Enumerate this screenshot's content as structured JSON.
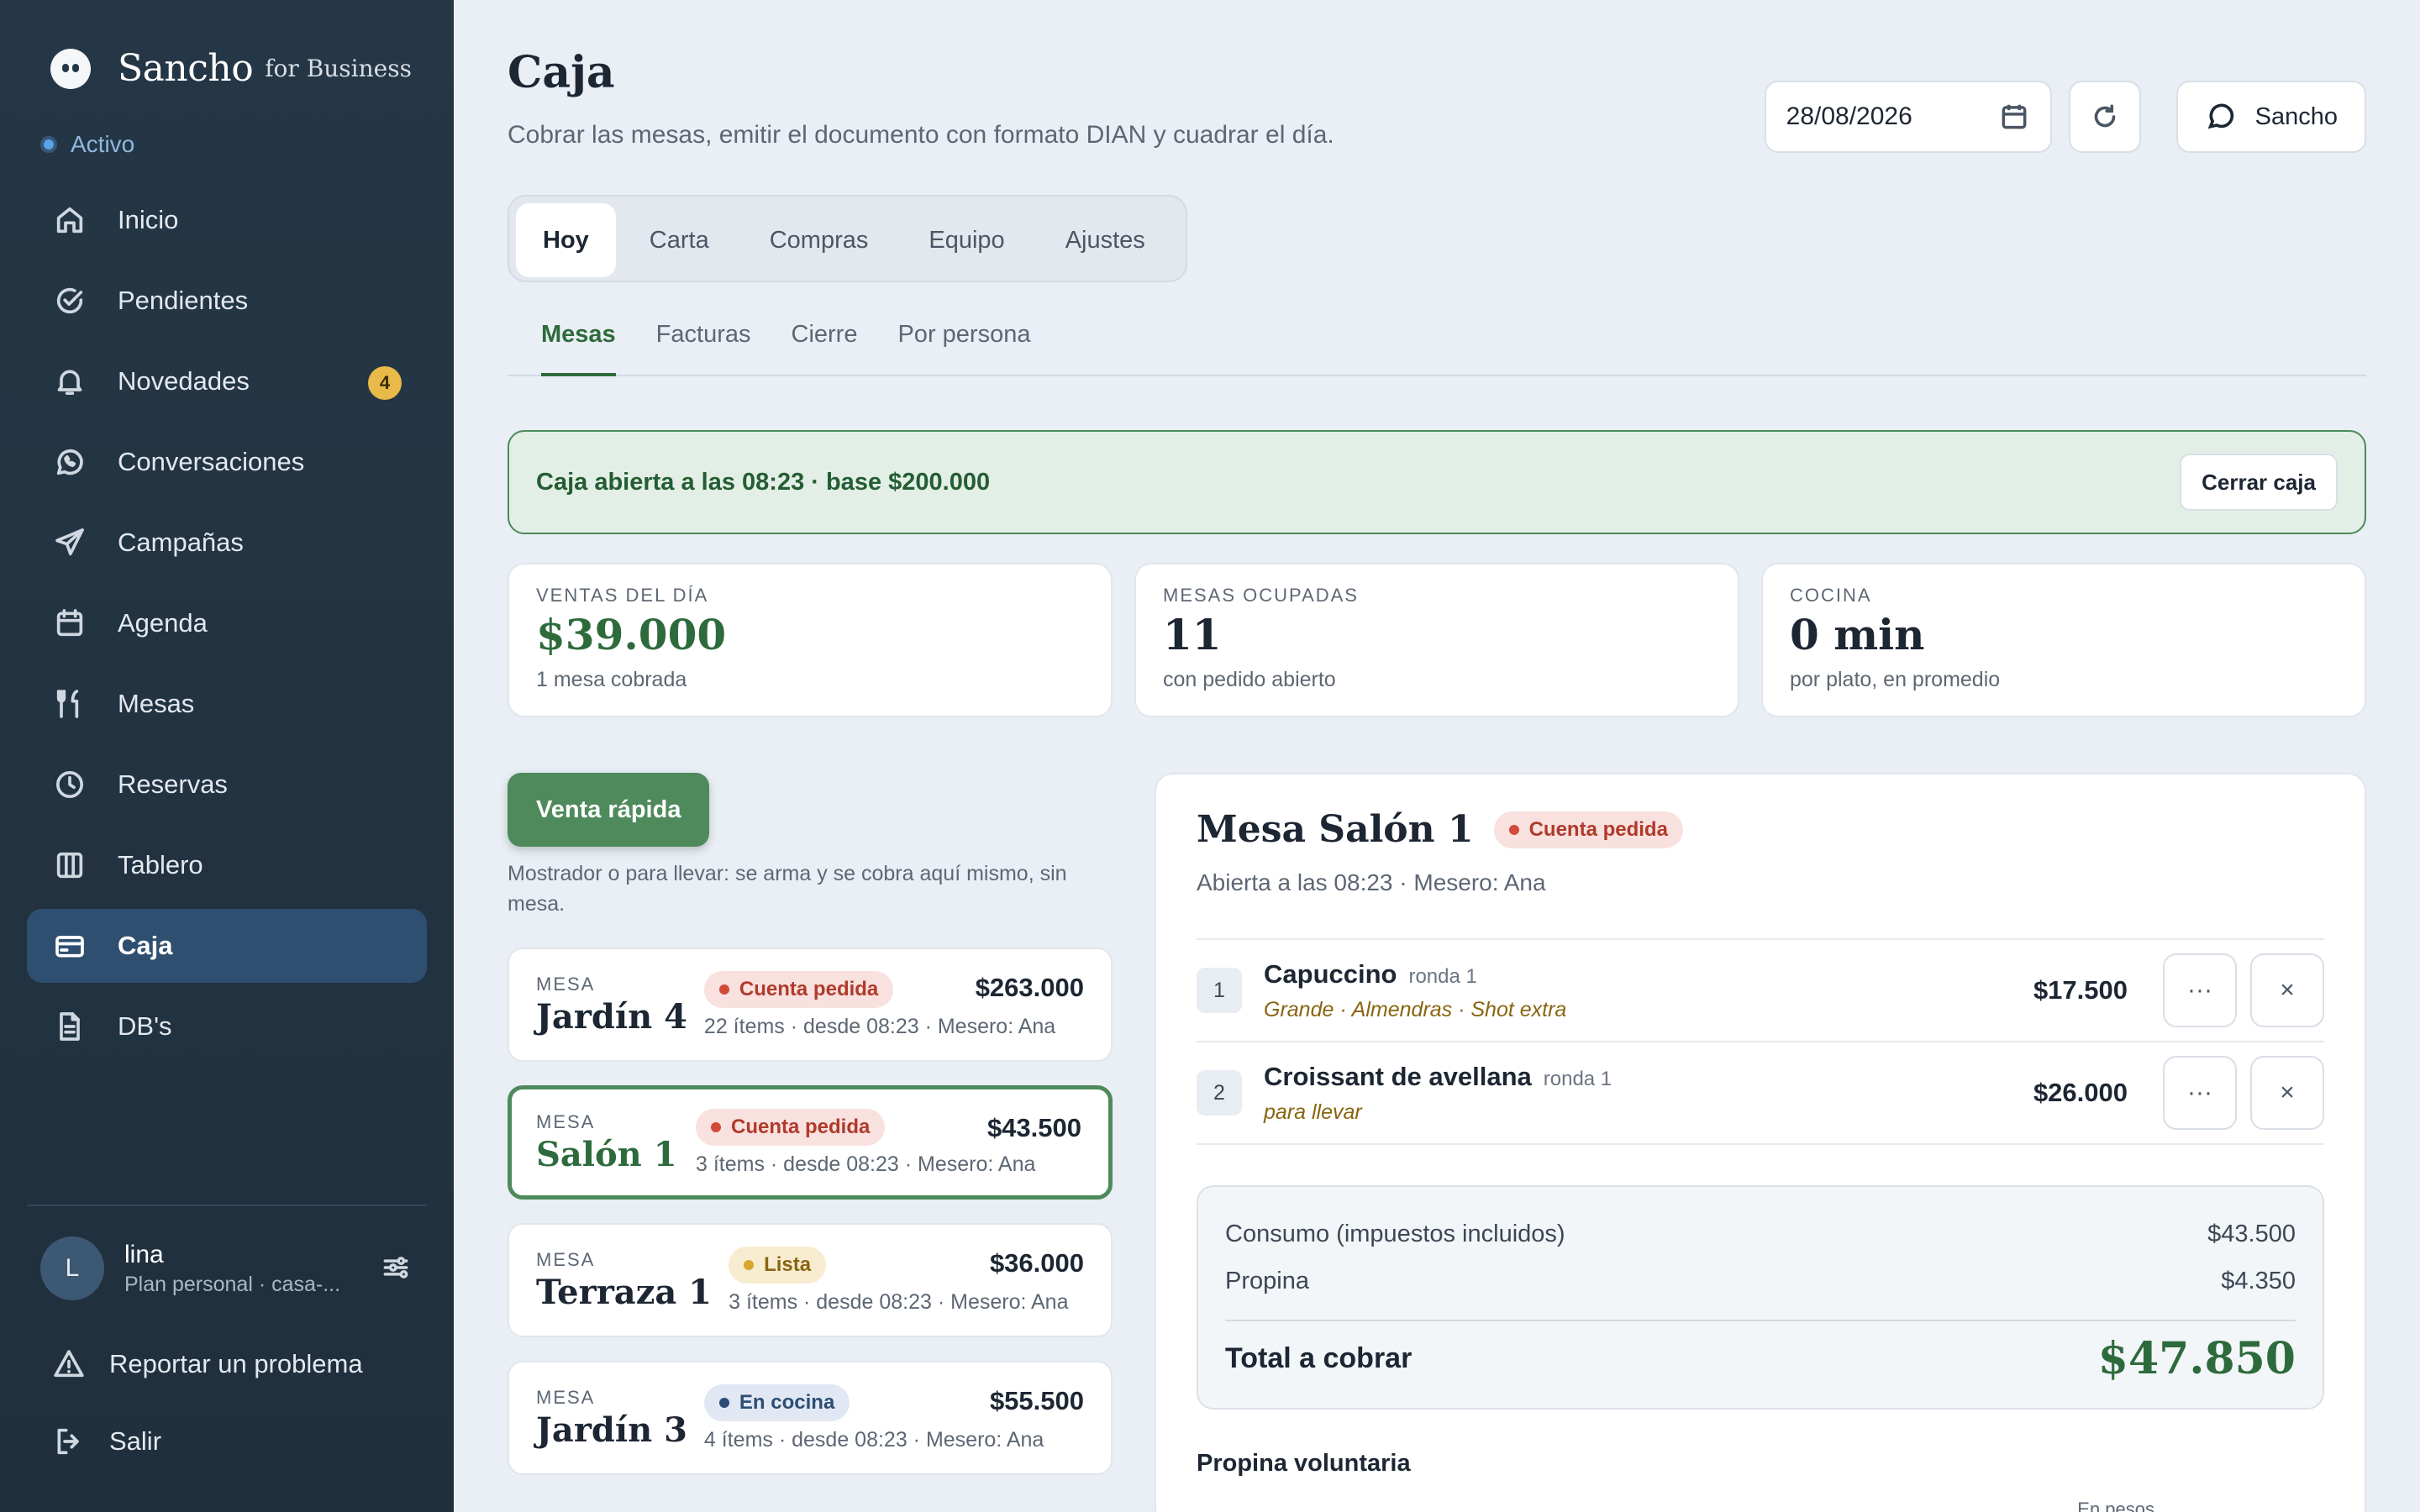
{
  "brand": {
    "name": "Sancho",
    "suffix": "for Business"
  },
  "status": {
    "label": "Activo"
  },
  "nav": {
    "items": [
      {
        "label": "Inicio",
        "icon": "home-icon"
      },
      {
        "label": "Pendientes",
        "icon": "check-circle-icon"
      },
      {
        "label": "Novedades",
        "icon": "bell-icon",
        "badge": "4"
      },
      {
        "label": "Conversaciones",
        "icon": "whatsapp-icon"
      },
      {
        "label": "Campañas",
        "icon": "send-icon"
      },
      {
        "label": "Agenda",
        "icon": "calendar-icon"
      },
      {
        "label": "Mesas",
        "icon": "utensils-icon"
      },
      {
        "label": "Reservas",
        "icon": "clock-icon"
      },
      {
        "label": "Tablero",
        "icon": "columns-icon"
      },
      {
        "label": "Caja",
        "icon": "credit-card-icon",
        "active": true
      },
      {
        "label": "DB's",
        "icon": "document-icon"
      }
    ]
  },
  "user": {
    "initial": "L",
    "name": "lina",
    "plan": "Plan personal · casa-..."
  },
  "footer": {
    "report": "Reportar un problema",
    "logout": "Salir"
  },
  "header": {
    "title": "Caja",
    "subtitle": "Cobrar las mesas, emitir el documento con formato DIAN y cuadrar el día.",
    "date": "28/08/2026",
    "sancho_button": "Sancho"
  },
  "tabs": [
    "Hoy",
    "Carta",
    "Compras",
    "Equipo",
    "Ajustes"
  ],
  "subtabs": [
    "Mesas",
    "Facturas",
    "Cierre",
    "Por persona"
  ],
  "banner": {
    "text": "Caja abierta a las 08:23 · base $200.000",
    "button": "Cerrar caja"
  },
  "stats": [
    {
      "label": "VENTAS DEL DÍA",
      "value": "$39.000",
      "note": "1 mesa cobrada"
    },
    {
      "label": "MESAS OCUPADAS",
      "value": "11",
      "note": "con pedido abierto"
    },
    {
      "label": "COCINA",
      "value": "0 min",
      "note": "por plato, en promedio"
    }
  ],
  "quick_sale": {
    "button": "Venta rápida",
    "note": "Mostrador o para llevar: se arma y se cobra aquí mismo, sin mesa."
  },
  "tables": [
    {
      "kicker": "MESA",
      "name": "Jardín 4",
      "status": "Cuenta pedida",
      "meta": "22 ítems · desde 08:23 · Mesero: Ana",
      "amount": "$263.000"
    },
    {
      "kicker": "MESA",
      "name": "Salón 1",
      "status": "Cuenta pedida",
      "meta": "3 ítems · desde 08:23 · Mesero: Ana",
      "amount": "$43.500"
    },
    {
      "kicker": "MESA",
      "name": "Terraza 1",
      "status": "Lista",
      "meta": "3 ítems · desde 08:23 · Mesero: Ana",
      "amount": "$36.000"
    },
    {
      "kicker": "MESA",
      "name": "Jardín 3",
      "status": "En cocina",
      "meta": "4 ítems · desde 08:23 · Mesero: Ana",
      "amount": "$55.500"
    }
  ],
  "detail": {
    "title": "Mesa Salón 1",
    "status": "Cuenta pedida",
    "subtitle": "Abierta a las 08:23 · Mesero: Ana",
    "items": [
      {
        "num": "1",
        "name": "Capuccino",
        "round": "ronda 1",
        "mods": "Grande · Almendras · Shot extra",
        "price": "$17.500"
      },
      {
        "num": "2",
        "name": "Croissant de avellana",
        "round": "ronda 1",
        "mods": "para llevar",
        "price": "$26.000"
      }
    ],
    "more_label": "···",
    "remove_label": "×",
    "totals": {
      "consumo_label": "Consumo (impuestos incluidos)",
      "consumo_value": "$43.500",
      "propina_label": "Propina",
      "propina_value": "$4.350",
      "total_label": "Total a cobrar",
      "total_value": "$47.850"
    },
    "tip_title": "Propina voluntaria",
    "tip_note": "En pesos"
  }
}
